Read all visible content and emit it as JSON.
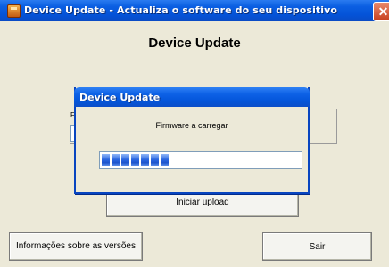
{
  "window": {
    "title": "Device Update - Actualiza o software do seu dispositivo",
    "close_label": "✕"
  },
  "main": {
    "heading": "Device Update",
    "upload_button": "Iniciar upload",
    "info_button": "Informações sobre as versões",
    "exit_button": "Sair",
    "hidden_field_letter": "F"
  },
  "dialog": {
    "title": "Device Update",
    "message": "Firmware a carregar",
    "progress": {
      "percent": 39,
      "blocks_filled": 7,
      "blocks_total": 18
    }
  },
  "colors": {
    "titlebar": "#0453d8",
    "progress_fill": "#2a66e0",
    "window_bg": "#ece9d8"
  }
}
